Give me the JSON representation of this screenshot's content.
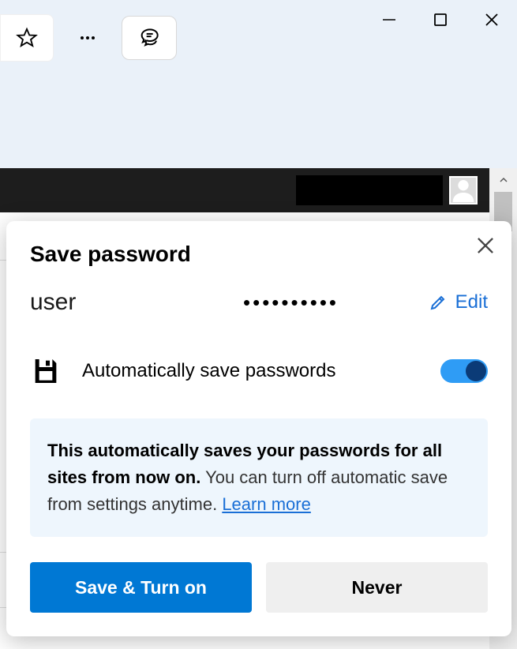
{
  "window_controls": {
    "minimize": "minimize",
    "maximize": "maximize",
    "close": "close"
  },
  "toolbar": {
    "favorite": "favorite",
    "more": "more",
    "chat": "chat"
  },
  "dialog": {
    "title": "Save password",
    "username": "user",
    "password_mask": "••••••••••",
    "edit_label": "Edit",
    "auto_save_label": "Automatically save passwords",
    "toggle_on": true,
    "info_bold": "This automatically saves your passwords for all sites from now on.",
    "info_rest": " You can turn off automatic save from settings anytime. ",
    "learn_more": "Learn more",
    "primary_button": "Save & Turn on",
    "secondary_button": "Never"
  },
  "colors": {
    "accent": "#0078d4",
    "link": "#1a6fd6",
    "info_bg": "#eef6fd"
  }
}
